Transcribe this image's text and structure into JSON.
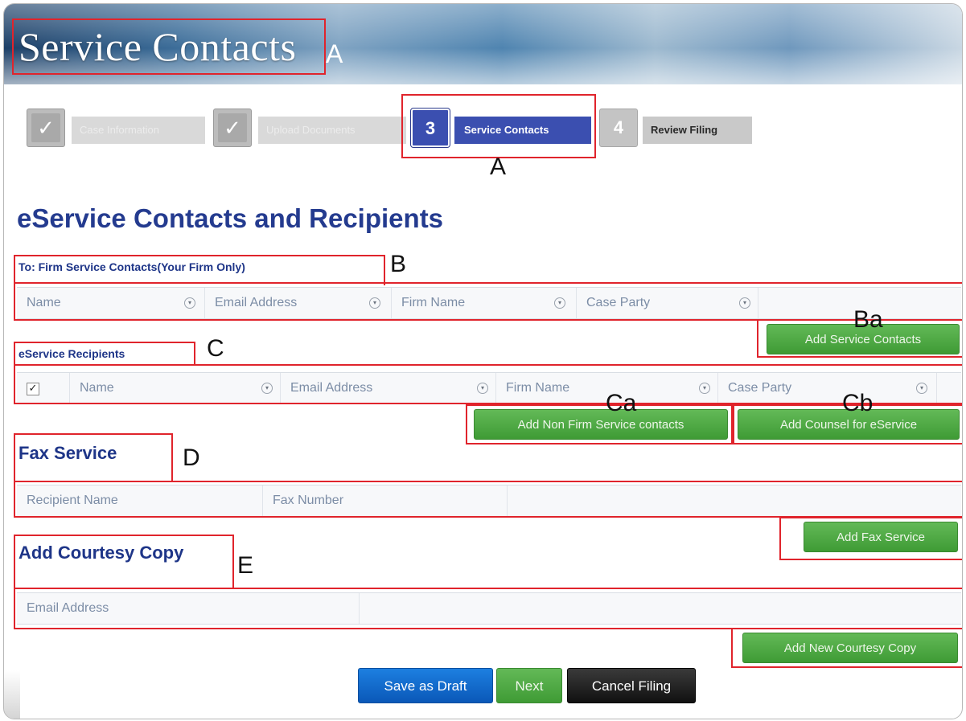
{
  "banner": {
    "title": "Service Contacts"
  },
  "steps": [
    {
      "kind": "done",
      "icon": "check-icon",
      "label": "Case Information"
    },
    {
      "kind": "done",
      "icon": "check-icon",
      "label": "Upload Documents"
    },
    {
      "kind": "active",
      "number": "3",
      "label": "Service Contacts"
    },
    {
      "kind": "pending",
      "number": "4",
      "label": "Review Filing"
    }
  ],
  "page_heading": "eService Contacts and Recipients",
  "firm_contacts": {
    "title": "To: Firm Service Contacts(Your Firm Only)",
    "columns": [
      "Name",
      "Email Address",
      "Firm Name",
      "Case Party"
    ],
    "add_button": "Add Service Contacts"
  },
  "recipients": {
    "title": "eService Recipients",
    "columns": [
      "Name",
      "Email Address",
      "Firm Name",
      "Case Party"
    ],
    "select_all_checked": true,
    "add_non_firm_button": "Add Non Firm Service contacts",
    "add_counsel_button": "Add Counsel for eService"
  },
  "fax": {
    "title": "Fax Service",
    "columns": [
      "Recipient Name",
      "Fax Number"
    ],
    "add_button": "Add Fax Service"
  },
  "courtesy": {
    "title": "Add Courtesy Copy",
    "columns": [
      "Email Address"
    ],
    "add_button": "Add New Courtesy Copy"
  },
  "actions": {
    "save_draft": "Save as Draft",
    "next": "Next",
    "cancel": "Cancel Filing"
  },
  "annotations": {
    "banner": "A",
    "step": "A",
    "firm": "B",
    "firm_button": "Ba",
    "recipients": "C",
    "recipients_non_firm": "Ca",
    "recipients_counsel": "Cb",
    "fax": "D",
    "courtesy": "E"
  },
  "colors": {
    "accent_blue": "#3b4fb0",
    "heading_blue": "#243b8f",
    "button_green": "#4caf45",
    "annotation_red": "#e0242c"
  }
}
